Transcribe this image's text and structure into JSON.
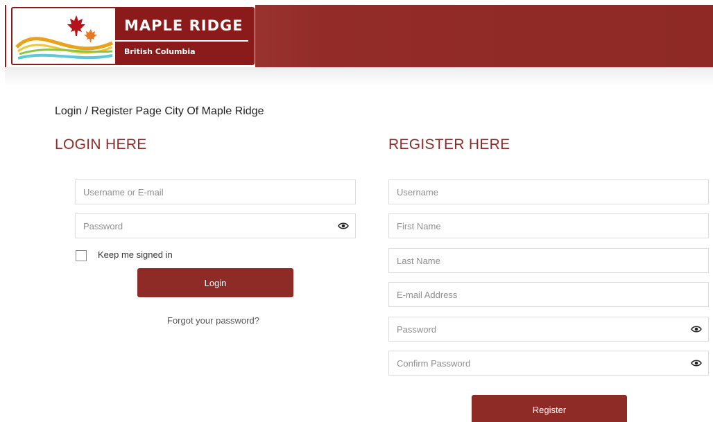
{
  "header": {
    "logo": {
      "title": "MAPLE RIDGE",
      "subtitle": "British Columbia"
    }
  },
  "page_title": "Login / Register Page City Of Maple Ridge",
  "login": {
    "heading": "LOGIN HERE",
    "username_placeholder": "Username or E-mail",
    "password_placeholder": "Password",
    "remember_label": "Keep me signed in",
    "remember_checked": false,
    "submit_label": "Login",
    "forgot_label": "Forgot your password?"
  },
  "register": {
    "heading": "REGISTER HERE",
    "username_placeholder": "Username",
    "first_name_placeholder": "First Name",
    "last_name_placeholder": "Last Name",
    "email_placeholder": "E-mail Address",
    "password_placeholder": "Password",
    "confirm_password_placeholder": "Confirm Password",
    "submit_label": "Register"
  },
  "icons": {
    "password_toggle": "eye-icon",
    "logo_emblem": "maple-leaf-icon"
  },
  "colors": {
    "brand_red": "#8e2b27",
    "logo_red": "#8b1a1a",
    "header_gradient_start": "#b06460"
  }
}
